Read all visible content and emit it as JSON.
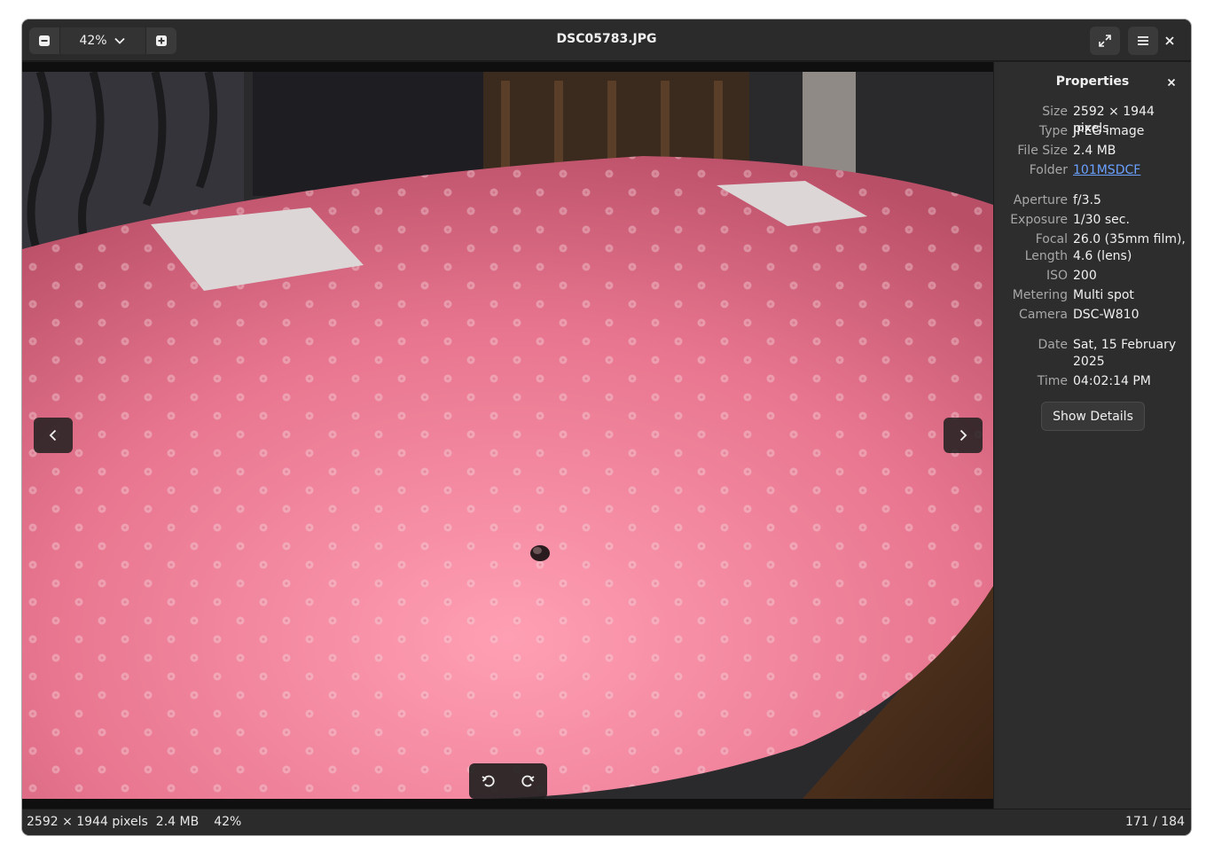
{
  "header": {
    "zoom_value": "42%",
    "title": "DSC05783.JPG"
  },
  "icons": {
    "zoom_out": "zoom-out-icon",
    "zoom_in": "zoom-in-icon",
    "dropdown": "chevron-down-icon",
    "fullscreen": "fullscreen-icon",
    "menu": "hamburger-menu-icon",
    "close": "close-icon",
    "prev": "chevron-left-icon",
    "next": "chevron-right-icon",
    "rotate_left": "rotate-left-icon",
    "rotate_right": "rotate-right-icon"
  },
  "properties": {
    "title": "Properties",
    "rows": [
      {
        "label": "Size",
        "value": "2592 × 1944 pixels"
      },
      {
        "label": "Type",
        "value": "JPEG image"
      },
      {
        "label": "File Size",
        "value": "2.4 MB"
      },
      {
        "label": "Folder",
        "value": "101MSDCF"
      },
      {
        "label": "Aperture",
        "value": "f/3.5"
      },
      {
        "label": "Exposure",
        "value": "1/30 sec."
      },
      {
        "label": "Focal Length",
        "value": "26.0 (35mm film), 4.6 (lens)"
      },
      {
        "label": "ISO",
        "value": "200"
      },
      {
        "label": "Metering",
        "value": "Multi spot"
      },
      {
        "label": "Camera",
        "value": "DSC-W810"
      },
      {
        "label": "Date",
        "value": "Sat, 15 February 2025"
      },
      {
        "label": "Time",
        "value": "04:02:14 PM"
      }
    ],
    "show_details_label": "Show Details"
  },
  "status": {
    "dimensions": "2592 × 1944 pixels",
    "file_size": "2.4 MB",
    "zoom": "42%",
    "position": "171 / 184"
  },
  "colors": {
    "window_bg": "#1e1e1e",
    "header_bg": "#2b2b2b",
    "panel_bg": "#2d2d2d",
    "link": "#6aa0ff",
    "tablecloth": "#e8758f"
  }
}
